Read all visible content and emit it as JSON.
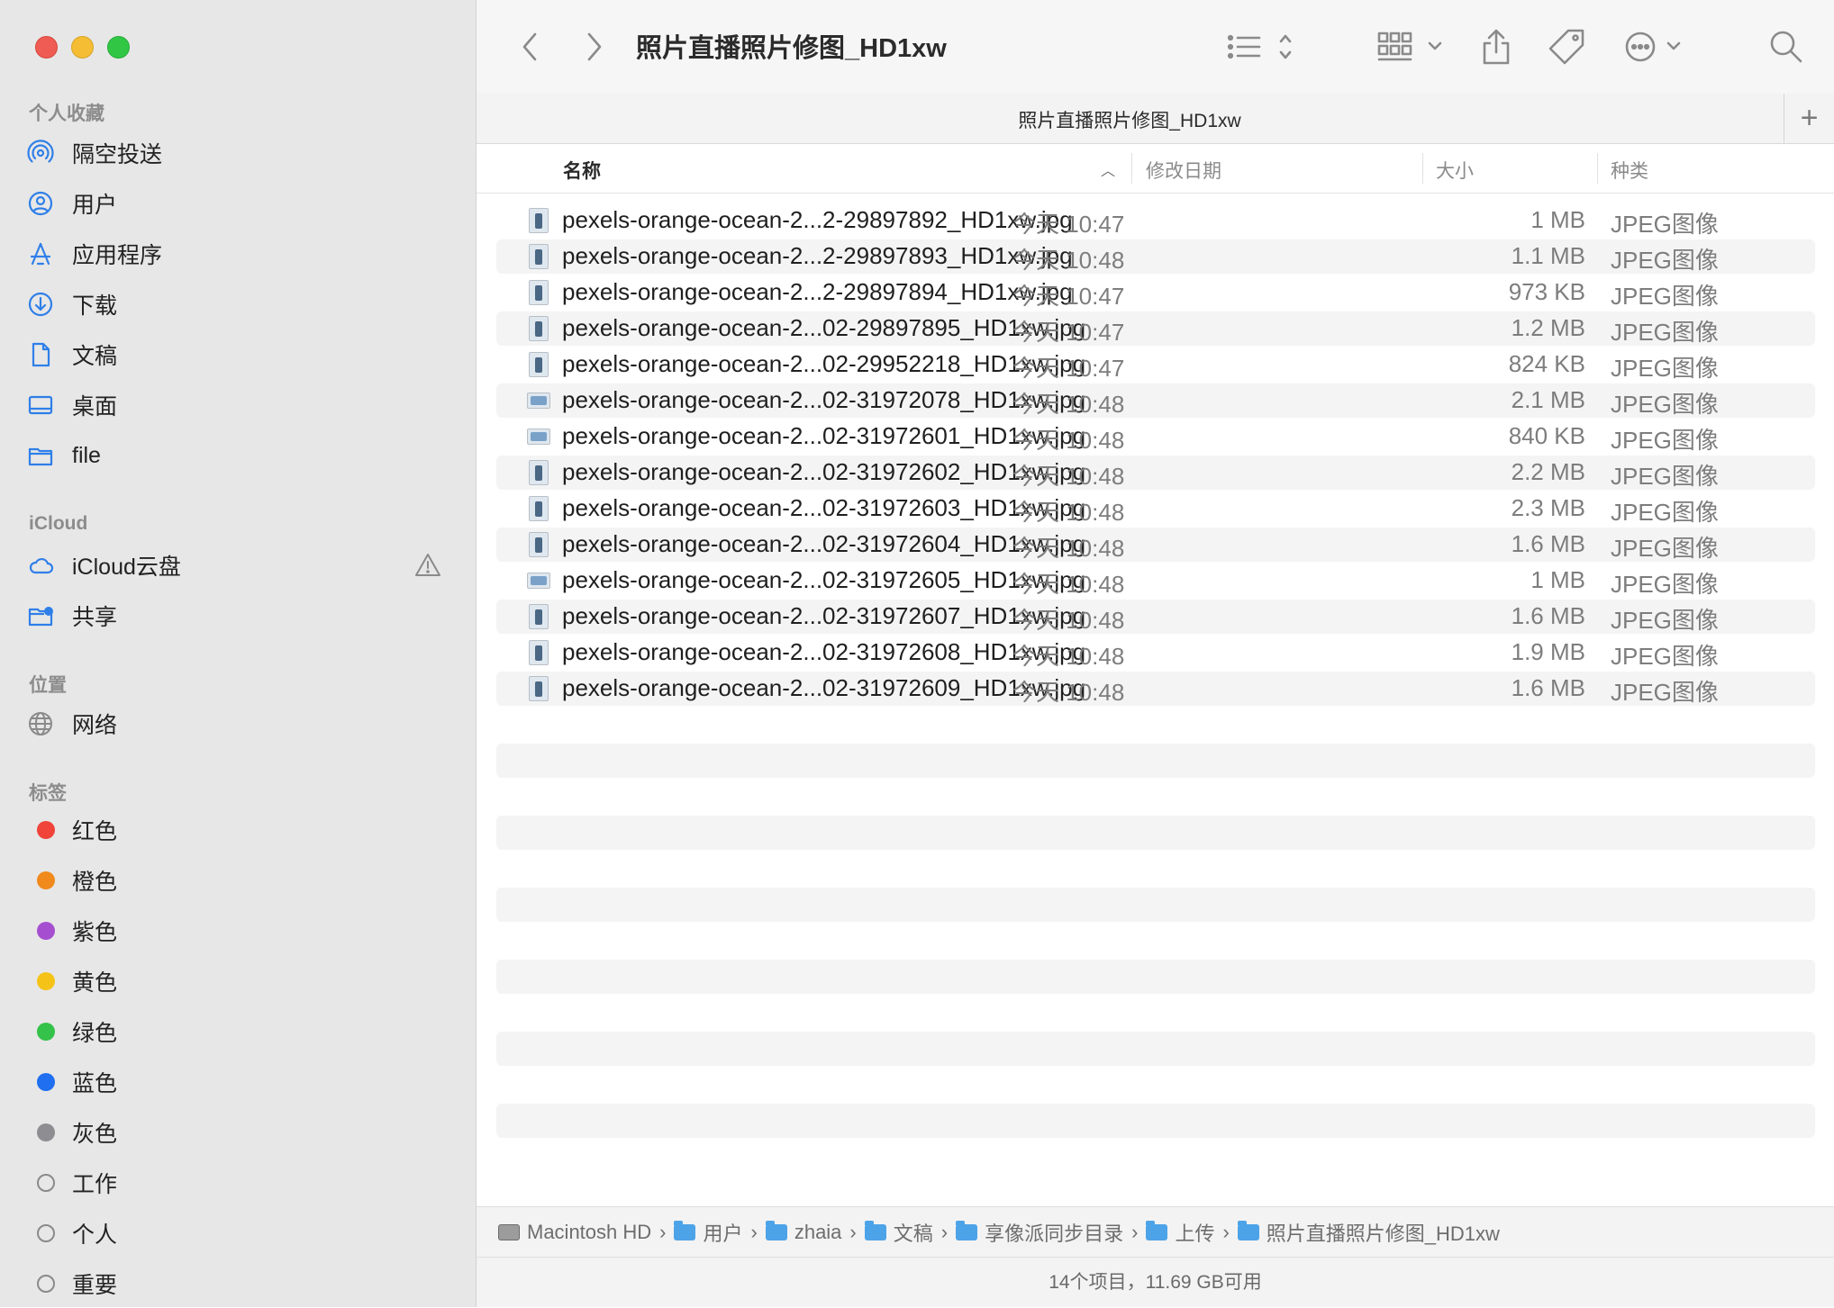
{
  "window": {
    "title": "照片直播照片修图_HD1xw",
    "tab_title": "照片直播照片修图_HD1xw",
    "tab_add": "+"
  },
  "sidebar": {
    "sections": [
      {
        "heading": "个人收藏",
        "items": [
          {
            "label": "隔空投送",
            "icon": "airdrop-icon"
          },
          {
            "label": "用户",
            "icon": "user-icon"
          },
          {
            "label": "应用程序",
            "icon": "applications-icon"
          },
          {
            "label": "下载",
            "icon": "download-icon"
          },
          {
            "label": "文稿",
            "icon": "document-icon"
          },
          {
            "label": "桌面",
            "icon": "desktop-icon"
          },
          {
            "label": "file",
            "icon": "folder-icon"
          }
        ]
      },
      {
        "heading": "iCloud",
        "items": [
          {
            "label": "iCloud云盘",
            "icon": "cloud-icon",
            "badge": "warning-icon"
          },
          {
            "label": "共享",
            "icon": "shared-folder-icon"
          }
        ]
      },
      {
        "heading": "位置",
        "items": [
          {
            "label": "网络",
            "icon": "network-globe-icon"
          }
        ]
      },
      {
        "heading": "标签",
        "items": [
          {
            "label": "红色",
            "color": "#f0433a"
          },
          {
            "label": "橙色",
            "color": "#f08a1c"
          },
          {
            "label": "紫色",
            "color": "#a54fd0"
          },
          {
            "label": "黄色",
            "color": "#f5c317"
          },
          {
            "label": "绿色",
            "color": "#35c24a"
          },
          {
            "label": "蓝色",
            "color": "#1f6ff0"
          },
          {
            "label": "灰色",
            "color": "#8e8e92"
          },
          {
            "label": "工作",
            "color": ""
          },
          {
            "label": "个人",
            "color": ""
          },
          {
            "label": "重要",
            "color": ""
          }
        ]
      }
    ]
  },
  "columns": {
    "name": "名称",
    "date": "修改日期",
    "size": "大小",
    "kind": "种类"
  },
  "files": [
    {
      "name": "pexels-orange-ocean-2...2-29897892_HD1xw.jpg",
      "date": "今天 10:47",
      "size": "1 MB",
      "kind": "JPEG图像",
      "orientation": "portrait"
    },
    {
      "name": "pexels-orange-ocean-2...2-29897893_HD1xw.jpg",
      "date": "今天 10:48",
      "size": "1.1 MB",
      "kind": "JPEG图像",
      "orientation": "portrait"
    },
    {
      "name": "pexels-orange-ocean-2...2-29897894_HD1xw.jpg",
      "date": "今天 10:47",
      "size": "973 KB",
      "kind": "JPEG图像",
      "orientation": "portrait"
    },
    {
      "name": "pexels-orange-ocean-2...02-29897895_HD1xw.jpg",
      "date": "今天 10:47",
      "size": "1.2 MB",
      "kind": "JPEG图像",
      "orientation": "portrait"
    },
    {
      "name": "pexels-orange-ocean-2...02-29952218_HD1xw.jpg",
      "date": "今天 10:47",
      "size": "824 KB",
      "kind": "JPEG图像",
      "orientation": "portrait"
    },
    {
      "name": "pexels-orange-ocean-2...02-31972078_HD1xw.jpg",
      "date": "今天 10:48",
      "size": "2.1 MB",
      "kind": "JPEG图像",
      "orientation": "landscape"
    },
    {
      "name": "pexels-orange-ocean-2...02-31972601_HD1xw.jpg",
      "date": "今天 10:48",
      "size": "840 KB",
      "kind": "JPEG图像",
      "orientation": "landscape"
    },
    {
      "name": "pexels-orange-ocean-2...02-31972602_HD1xw.jpg",
      "date": "今天 10:48",
      "size": "2.2 MB",
      "kind": "JPEG图像",
      "orientation": "portrait"
    },
    {
      "name": "pexels-orange-ocean-2...02-31972603_HD1xw.jpg",
      "date": "今天 10:48",
      "size": "2.3 MB",
      "kind": "JPEG图像",
      "orientation": "portrait"
    },
    {
      "name": "pexels-orange-ocean-2...02-31972604_HD1xw.jpg",
      "date": "今天 10:48",
      "size": "1.6 MB",
      "kind": "JPEG图像",
      "orientation": "portrait"
    },
    {
      "name": "pexels-orange-ocean-2...02-31972605_HD1xw.jpg",
      "date": "今天 10:48",
      "size": "1 MB",
      "kind": "JPEG图像",
      "orientation": "landscape"
    },
    {
      "name": "pexels-orange-ocean-2...02-31972607_HD1xw.jpg",
      "date": "今天 10:48",
      "size": "1.6 MB",
      "kind": "JPEG图像",
      "orientation": "portrait"
    },
    {
      "name": "pexels-orange-ocean-2...02-31972608_HD1xw.jpg",
      "date": "今天 10:48",
      "size": "1.9 MB",
      "kind": "JPEG图像",
      "orientation": "portrait"
    },
    {
      "name": "pexels-orange-ocean-2...02-31972609_HD1xw.jpg",
      "date": "今天 10:48",
      "size": "1.6 MB",
      "kind": "JPEG图像",
      "orientation": "portrait"
    }
  ],
  "pathbar": [
    {
      "label": "Macintosh HD",
      "icon": "disk-icon"
    },
    {
      "label": "用户",
      "icon": "folder-icon"
    },
    {
      "label": "zhaia",
      "icon": "folder-icon"
    },
    {
      "label": "文稿",
      "icon": "folder-icon"
    },
    {
      "label": "享像派同步目录",
      "icon": "folder-icon"
    },
    {
      "label": "上传",
      "icon": "folder-icon"
    },
    {
      "label": "照片直播照片修图_HD1xw",
      "icon": "folder-icon"
    }
  ],
  "status": "14个项目，11.69 GB可用",
  "colors": {
    "sidebar_bg": "#e7e7e7",
    "accent": "#1f6ff0",
    "row_stripe": "#f4f4f4"
  }
}
